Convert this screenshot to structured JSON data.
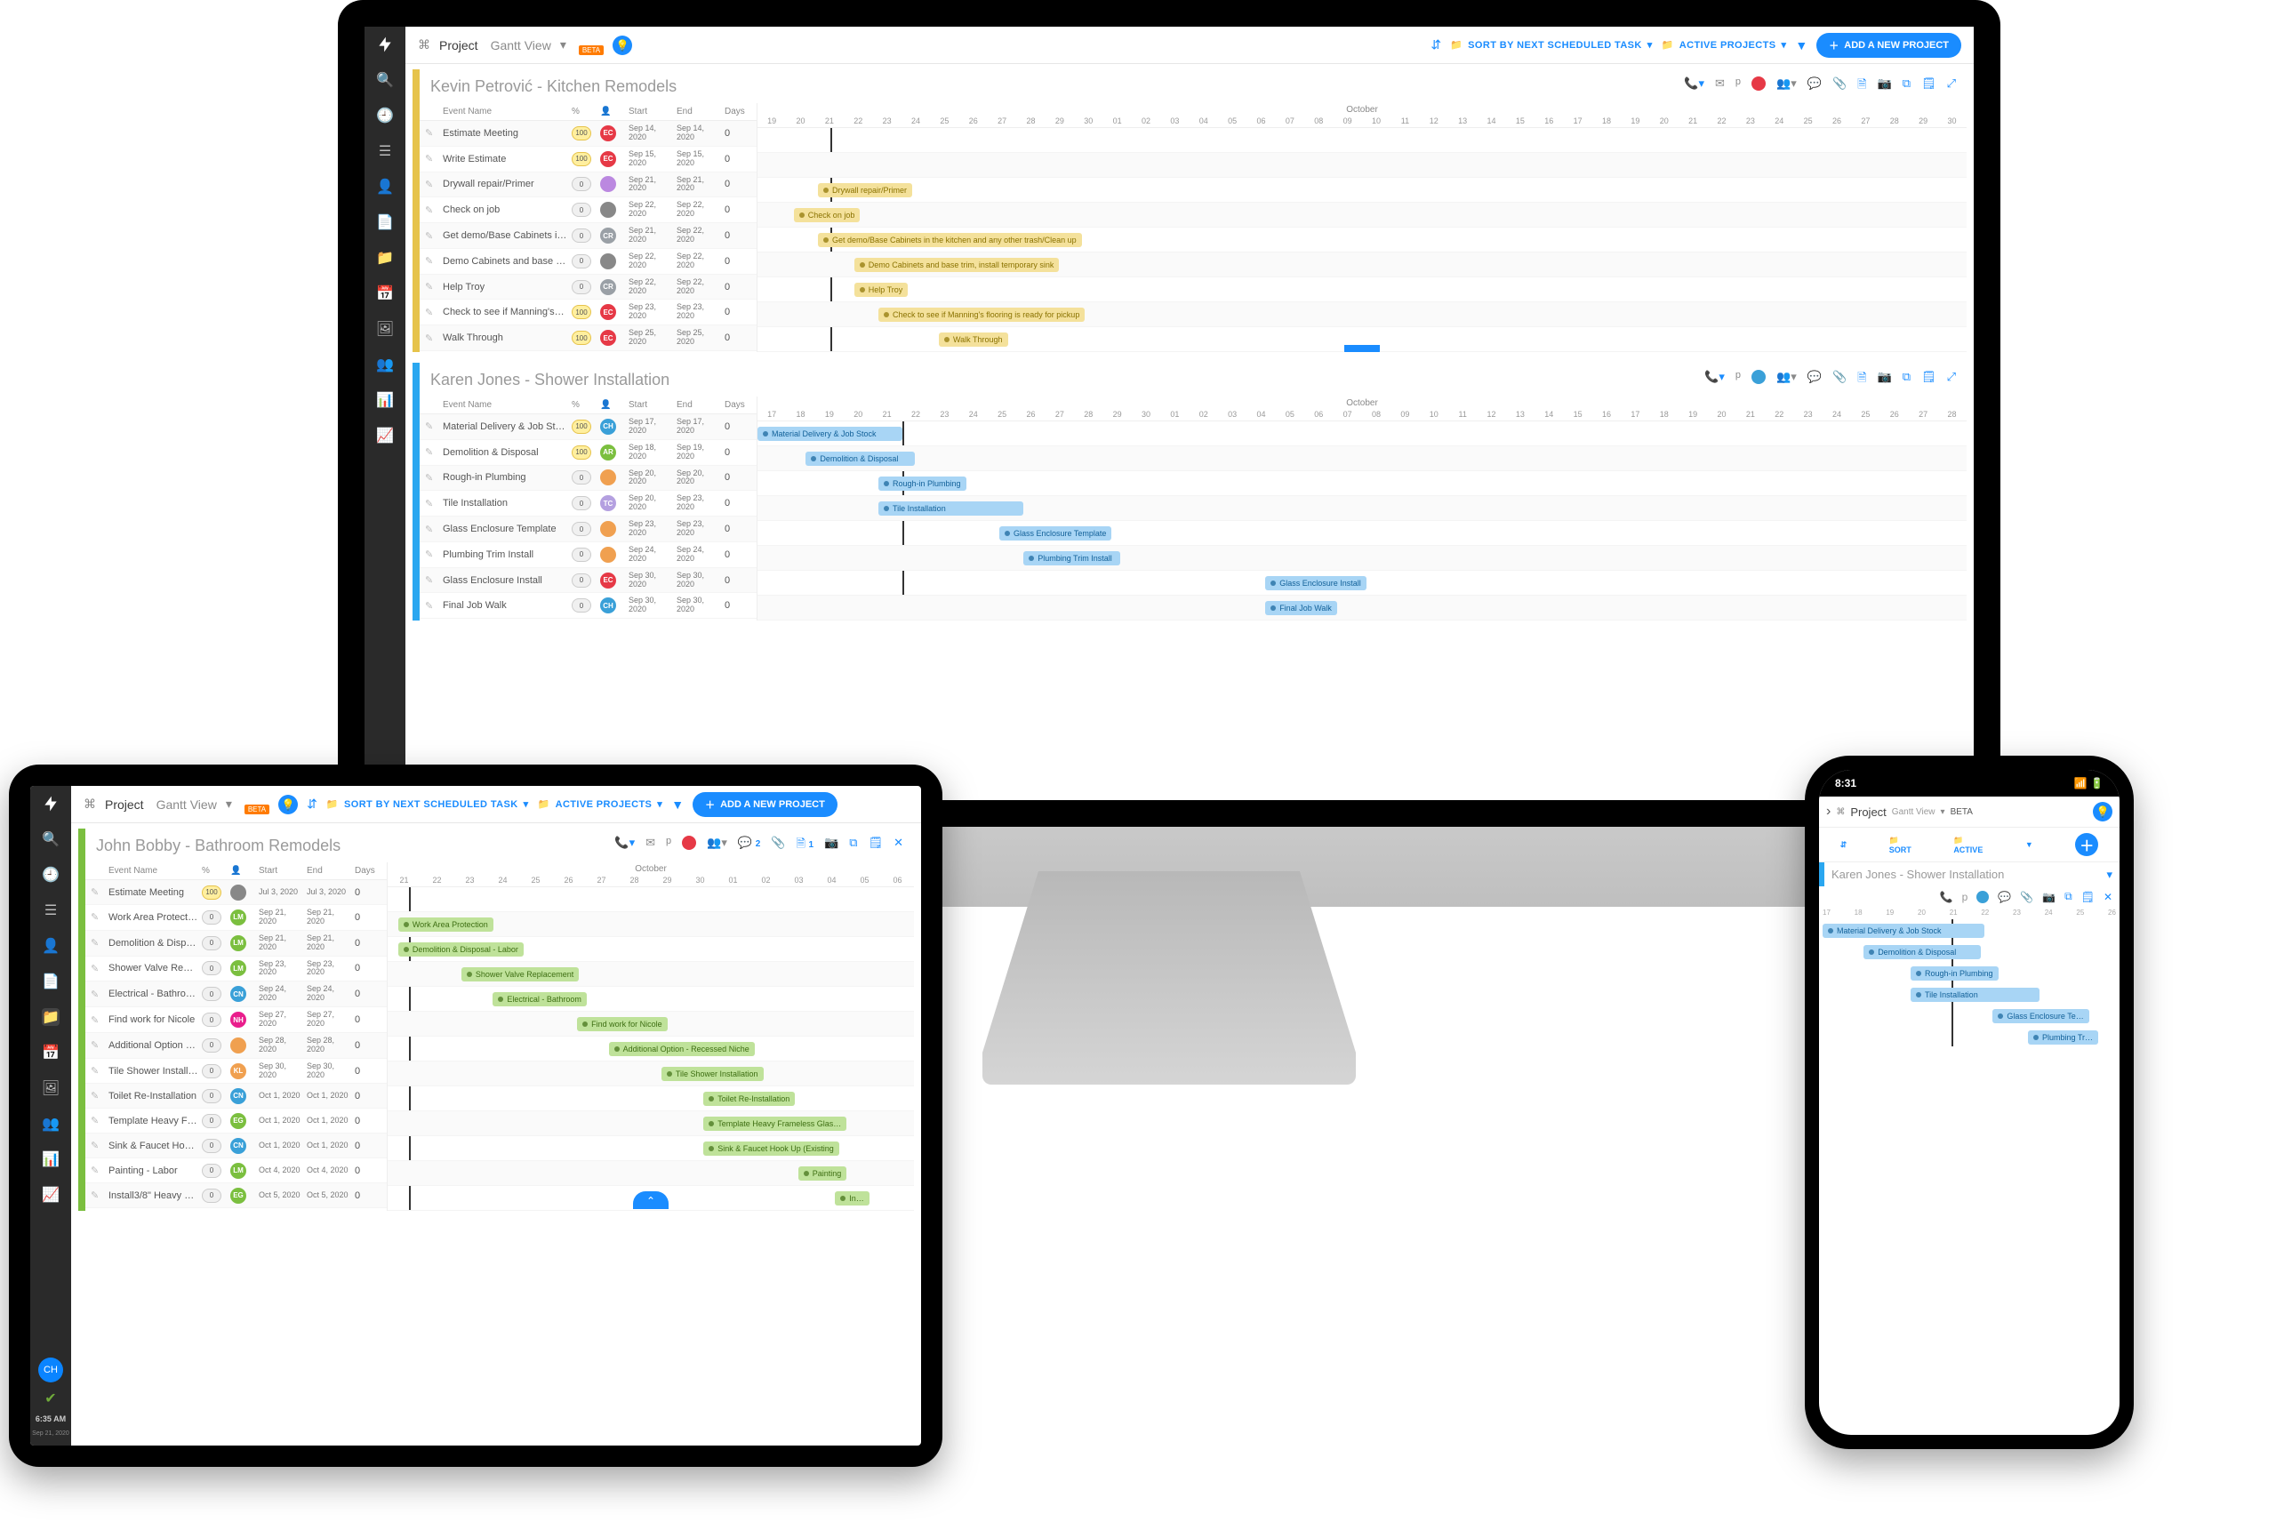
{
  "brand": {
    "product": "Project",
    "view": "Gantt View",
    "beta": "BETA"
  },
  "topbar": {
    "sort_label": "SORT BY NEXT SCHEDULED TASK",
    "filter_projects_label": "ACTIVE PROJECTS",
    "add_label": "ADD A NEW PROJECT",
    "sort_short": "SORT",
    "active_short": "ACTIVE"
  },
  "month": "October",
  "desktop_days": [
    "19",
    "20",
    "21",
    "22",
    "23",
    "24",
    "25",
    "26",
    "27",
    "28",
    "29",
    "30",
    "01",
    "02",
    "03",
    "04",
    "05",
    "06",
    "07",
    "08",
    "09",
    "10",
    "11",
    "12",
    "13",
    "14",
    "15",
    "16",
    "17",
    "18",
    "19",
    "20",
    "21",
    "22",
    "23",
    "24",
    "25",
    "26",
    "27",
    "28",
    "29",
    "30"
  ],
  "desktop_days_p2": [
    "17",
    "18",
    "19",
    "20",
    "21",
    "22",
    "23",
    "24",
    "25",
    "26",
    "27",
    "28",
    "29",
    "30",
    "01",
    "02",
    "03",
    "04",
    "05",
    "06",
    "07",
    "08",
    "09",
    "10",
    "11",
    "12",
    "13",
    "14",
    "15",
    "16",
    "17",
    "18",
    "19",
    "20",
    "21",
    "22",
    "23",
    "24",
    "25",
    "26",
    "27",
    "28"
  ],
  "tablet_days": [
    "21",
    "22",
    "23",
    "24",
    "25",
    "26",
    "27",
    "28",
    "29",
    "30",
    "01",
    "02",
    "03",
    "04",
    "05",
    "06"
  ],
  "phone_days": [
    "17",
    "18",
    "19",
    "20",
    "21",
    "22",
    "23",
    "24",
    "25",
    "26"
  ],
  "cols": {
    "name": "Event Name",
    "pct": "%",
    "asg": "",
    "start": "Start",
    "end": "End",
    "days": "Days"
  },
  "projects": {
    "p1": {
      "title": "Kevin Petrović - Kitchen Remodels",
      "accent": "#e6c34b",
      "tasks": [
        {
          "n": "Estimate Meeting",
          "p": "100",
          "a": "EC",
          "ac": "#e63946",
          "s": "Sep 14, 2020",
          "e": "Sep 14, 2020",
          "d": "0",
          "bar": "Estimate Meeting",
          "x": 0,
          "w": 0
        },
        {
          "n": "Write Estimate",
          "p": "100",
          "a": "EC",
          "ac": "#e63946",
          "s": "Sep 15, 2020",
          "e": "Sep 15, 2020",
          "d": "0",
          "bar": "Write Estimate",
          "x": 0,
          "w": 0
        },
        {
          "n": "Drywall repair/Primer",
          "p": "0",
          "a": "",
          "ac": "#bb88e0",
          "s": "Sep 21, 2020",
          "e": "Sep 21, 2020",
          "d": "0",
          "bar": "Drywall repair/Primer",
          "x": 5,
          "w": 3
        },
        {
          "n": "Check on job",
          "p": "0",
          "a": "",
          "ac": "#888",
          "s": "Sep 22, 2020",
          "e": "Sep 22, 2020",
          "d": "0",
          "bar": "Check on job",
          "x": 3,
          "w": 5
        },
        {
          "n": "Get demo/Base Cabinets i…",
          "p": "0",
          "a": "CR",
          "ac": "#9aa0a6",
          "s": "Sep 21, 2020",
          "e": "Sep 22, 2020",
          "d": "0",
          "bar": "Get demo/Base Cabinets in the kitchen and any other trash/Clean up",
          "x": 5,
          "w": 5
        },
        {
          "n": "Demo Cabinets and base …",
          "p": "0",
          "a": "",
          "ac": "#888",
          "s": "Sep 22, 2020",
          "e": "Sep 22, 2020",
          "d": "0",
          "bar": "Demo Cabinets and base trim, install temporary sink",
          "x": 8,
          "w": 5
        },
        {
          "n": "Help Troy",
          "p": "0",
          "a": "CR",
          "ac": "#9aa0a6",
          "s": "Sep 22, 2020",
          "e": "Sep 22, 2020",
          "d": "0",
          "bar": "Help Troy",
          "x": 8,
          "w": 3
        },
        {
          "n": "Check to see if Manning's…",
          "p": "100",
          "a": "EC",
          "ac": "#e63946",
          "s": "Sep 23, 2020",
          "e": "Sep 23, 2020",
          "d": "0",
          "bar": "Check to see if Manning's flooring is ready for pickup",
          "x": 10,
          "w": 5
        },
        {
          "n": "Walk Through",
          "p": "100",
          "a": "EC",
          "ac": "#e63946",
          "s": "Sep 25, 2020",
          "e": "Sep 25, 2020",
          "d": "0",
          "bar": "Walk Through",
          "x": 15,
          "w": 4
        }
      ]
    },
    "p2": {
      "title": "Karen Jones - Shower Installation",
      "accent": "#2aa7f0",
      "tasks": [
        {
          "n": "Material Delivery & Job St…",
          "p": "100",
          "a": "CH",
          "ac": "#3aa0d8",
          "s": "Sep 17, 2020",
          "e": "Sep 17, 2020",
          "d": "0",
          "bar": "Material Delivery & Job Stock",
          "x": 0,
          "w": 12
        },
        {
          "n": "Demolition & Disposal",
          "p": "100",
          "a": "AR",
          "ac": "#7bbf3f",
          "s": "Sep 18, 2020",
          "e": "Sep 19, 2020",
          "d": "0",
          "bar": "Demolition & Disposal",
          "x": 4,
          "w": 9
        },
        {
          "n": "Rough-in Plumbing",
          "p": "0",
          "a": "",
          "ac": "#f0a050",
          "s": "Sep 20, 2020",
          "e": "Sep 20, 2020",
          "d": "0",
          "bar": "Rough-in Plumbing",
          "x": 10,
          "w": 5
        },
        {
          "n": "Tile Installation",
          "p": "0",
          "a": "TC",
          "ac": "#b4a0e0",
          "s": "Sep 20, 2020",
          "e": "Sep 23, 2020",
          "d": "0",
          "bar": "Tile Installation",
          "x": 10,
          "w": 12
        },
        {
          "n": "Glass Enclosure Template",
          "p": "0",
          "a": "",
          "ac": "#f0a050",
          "s": "Sep 23, 2020",
          "e": "Sep 23, 2020",
          "d": "0",
          "bar": "Glass Enclosure Template",
          "x": 20,
          "w": 5
        },
        {
          "n": "Plumbing Trim Install",
          "p": "0",
          "a": "",
          "ac": "#f0a050",
          "s": "Sep 24, 2020",
          "e": "Sep 24, 2020",
          "d": "0",
          "bar": "Plumbing Trim Install",
          "x": 22,
          "w": 8
        },
        {
          "n": "Glass Enclosure Install",
          "p": "0",
          "a": "EC",
          "ac": "#e63946",
          "s": "Sep 30, 2020",
          "e": "Sep 30, 2020",
          "d": "0",
          "bar": "Glass Enclosure Install",
          "x": 42,
          "w": 6
        },
        {
          "n": "Final Job Walk",
          "p": "0",
          "a": "CH",
          "ac": "#3aa0d8",
          "s": "Sep 30, 2020",
          "e": "Sep 30, 2020",
          "d": "0",
          "bar": "Final Job Walk",
          "x": 42,
          "w": 5
        }
      ]
    },
    "p3": {
      "title": "John Bobby - Bathroom Remodels",
      "accent": "#7bbf3f",
      "tasks": [
        {
          "n": "Estimate Meeting",
          "p": "100",
          "a": "",
          "ac": "#888",
          "s": "Jul 3, 2020",
          "e": "Jul 3, 2020",
          "d": "0",
          "bar": "",
          "x": 0,
          "w": 0
        },
        {
          "n": "Work Area Protection",
          "p": "0",
          "a": "LM",
          "ac": "#7bbf3f",
          "s": "Sep 21, 2020",
          "e": "Sep 21, 2020",
          "d": "0",
          "bar": "Work Area Protection",
          "x": 2,
          "w": 8
        },
        {
          "n": "Demolition & Disposal - L…",
          "p": "0",
          "a": "LM",
          "ac": "#7bbf3f",
          "s": "Sep 21, 2020",
          "e": "Sep 21, 2020",
          "d": "0",
          "bar": "Demolition & Disposal - Labor",
          "x": 2,
          "w": 8
        },
        {
          "n": "Shower Valve Replacement",
          "p": "0",
          "a": "LM",
          "ac": "#7bbf3f",
          "s": "Sep 23, 2020",
          "e": "Sep 23, 2020",
          "d": "0",
          "bar": "Shower Valve Replacement",
          "x": 14,
          "w": 10
        },
        {
          "n": "Electrical - Bathroom",
          "p": "0",
          "a": "CN",
          "ac": "#3aa0d8",
          "s": "Sep 24, 2020",
          "e": "Sep 24, 2020",
          "d": "0",
          "bar": "Electrical - Bathroom",
          "x": 20,
          "w": 10
        },
        {
          "n": "Find work for Nicole",
          "p": "0",
          "a": "NH",
          "ac": "#e91e8c",
          "s": "Sep 27, 2020",
          "e": "Sep 27, 2020",
          "d": "0",
          "bar": "Find work for Nicole",
          "x": 36,
          "w": 10
        },
        {
          "n": "Additional Option - Reces…",
          "p": "0",
          "a": "",
          "ac": "#f0a050",
          "s": "Sep 28, 2020",
          "e": "Sep 28, 2020",
          "d": "0",
          "bar": "Additional Option - Recessed Niche",
          "x": 42,
          "w": 10
        },
        {
          "n": "Tile Shower Installation",
          "p": "0",
          "a": "KL",
          "ac": "#f0a050",
          "s": "Sep 30, 2020",
          "e": "Sep 30, 2020",
          "d": "0",
          "bar": "Tile Shower Installation",
          "x": 52,
          "w": 12
        },
        {
          "n": "Toilet Re-Installation",
          "p": "0",
          "a": "CN",
          "ac": "#3aa0d8",
          "s": "Oct 1, 2020",
          "e": "Oct 1, 2020",
          "d": "0",
          "bar": "Toilet Re-Installation",
          "x": 60,
          "w": 10
        },
        {
          "n": "Template Heavy Frameles…",
          "p": "0",
          "a": "EG",
          "ac": "#7bbf3f",
          "s": "Oct 1, 2020",
          "e": "Oct 1, 2020",
          "d": "0",
          "bar": "Template Heavy Frameless Glas…",
          "x": 60,
          "w": 14
        },
        {
          "n": "Sink & Faucet Hook Up (E…",
          "p": "0",
          "a": "CN",
          "ac": "#3aa0d8",
          "s": "Oct 1, 2020",
          "e": "Oct 1, 2020",
          "d": "0",
          "bar": "Sink & Faucet Hook Up (Existing",
          "x": 60,
          "w": 14
        },
        {
          "n": "Painting - Labor",
          "p": "0",
          "a": "LM",
          "ac": "#7bbf3f",
          "s": "Oct 4, 2020",
          "e": "Oct 4, 2020",
          "d": "0",
          "bar": "Painting",
          "x": 78,
          "w": 8
        },
        {
          "n": "Install3/8\" Heavy Framele…",
          "p": "0",
          "a": "EG",
          "ac": "#7bbf3f",
          "s": "Oct 5, 2020",
          "e": "Oct 5, 2020",
          "d": "0",
          "bar": "In…",
          "x": 85,
          "w": 6
        }
      ]
    }
  },
  "nav": {
    "items": [
      "logo",
      "search",
      "clock",
      "list",
      "user",
      "file",
      "folder",
      "calendar",
      "image",
      "users",
      "chart-pie",
      "chart-bar"
    ],
    "avatar": "CH",
    "time": "6:35 AM",
    "date": "Sep 21, 2020"
  },
  "phone": {
    "time": "8:31",
    "project_title": "Karen Jones - Shower Installation",
    "bars": [
      "Material Delivery & Job Stock",
      "Demolition & Disposal",
      "Rough-in Plumbing",
      "Tile Installation",
      "Glass Enclosure Te…",
      "Plumbing Tr…"
    ]
  }
}
